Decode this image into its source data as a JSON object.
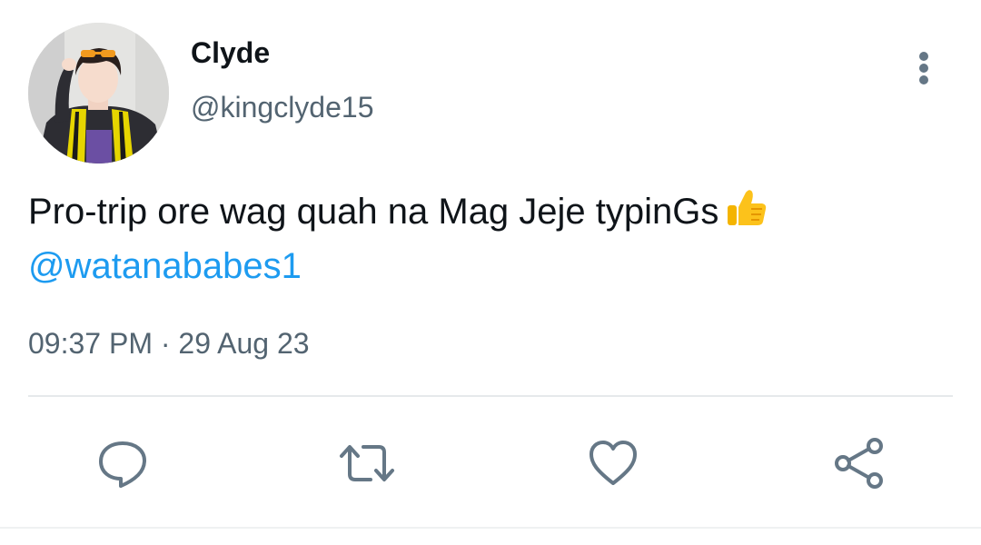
{
  "tweet": {
    "display_name": "Clyde",
    "handle": "@kingclyde15",
    "text": "Pro-trip ore wag quah na Mag Jeje typinGs",
    "emoji": "thumbs-up-emoji",
    "mention": "@watanababes1",
    "time": "09:37 PM",
    "separator": "·",
    "date": "29 Aug 23"
  },
  "menu_icon": "more-vertical-icon",
  "actions": [
    {
      "name": "reply",
      "icon": "comment-icon"
    },
    {
      "name": "retweet",
      "icon": "retweet-icon"
    },
    {
      "name": "like",
      "icon": "heart-icon"
    },
    {
      "name": "share",
      "icon": "share-icon"
    }
  ],
  "colors": {
    "text": "#0f1419",
    "secondary": "#536471",
    "link": "#1d9bf0",
    "icon": "#657786"
  }
}
